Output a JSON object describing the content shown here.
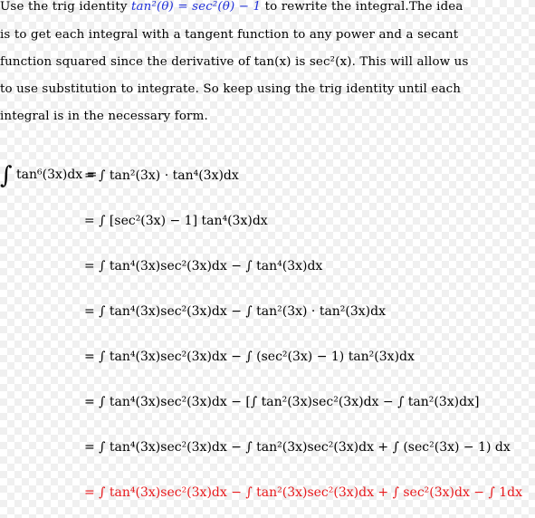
{
  "intro": {
    "line1_pre": "Use the trig identity ",
    "identity": "tan²(θ) = sec²(θ) − 1",
    "line1_post": " to rewrite the integral.The idea",
    "line2": "is to get each integral with a tangent function to any power and a secant",
    "line3": "function squared since the derivative of tan(x) is sec²(x). This will allow us",
    "line4": "to use substitution to integrate. So keep using the trig identity until each",
    "line5": "integral is in the necessary form."
  },
  "colors": {
    "identity": "#1f2fd8",
    "final_step": "#e8191c"
  },
  "derivation": {
    "integral_sign": "∫",
    "lhs": "tan⁶(3x)dx =",
    "rows": [
      "= ∫ tan²(3x) · tan⁴(3x)dx",
      "= ∫ [sec²(3x) − 1] tan⁴(3x)dx",
      "= ∫ tan⁴(3x)sec²(3x)dx − ∫ tan⁴(3x)dx",
      "= ∫ tan⁴(3x)sec²(3x)dx − ∫ tan²(3x) · tan²(3x)dx",
      "= ∫ tan⁴(3x)sec²(3x)dx − ∫ (sec²(3x) − 1) tan²(3x)dx",
      "= ∫ tan⁴(3x)sec²(3x)dx − [∫ tan²(3x)sec²(3x)dx − ∫ tan²(3x)dx]",
      "= ∫ tan⁴(3x)sec²(3x)dx − ∫ tan²(3x)sec²(3x)dx + ∫ (sec²(3x) − 1) dx",
      "= ∫ tan⁴(3x)sec²(3x)dx − ∫ tan²(3x)sec²(3x)dx + ∫ sec²(3x)dx − ∫ 1dx"
    ]
  }
}
